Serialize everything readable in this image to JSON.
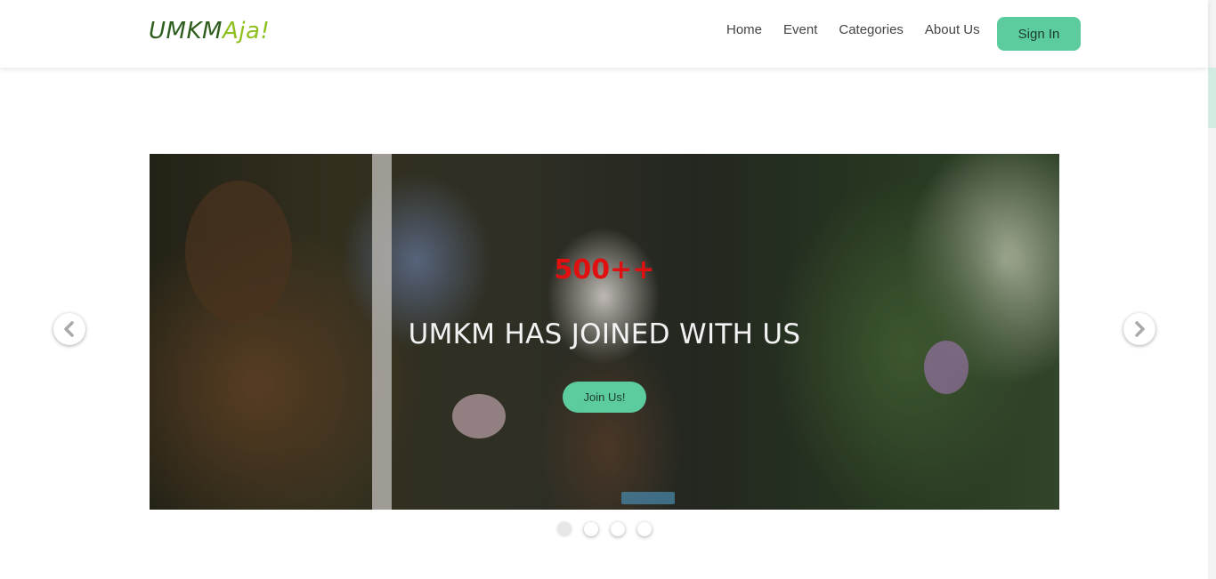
{
  "brand": {
    "logo_part1": "UMKM",
    "logo_part2": "Aja!",
    "logo_color1": "#2e5e1e",
    "logo_color2": "#8fbf1f"
  },
  "nav": {
    "links": [
      "Home",
      "Event",
      "Categories",
      "About Us"
    ],
    "sign_in_label": "Sign In"
  },
  "hero": {
    "count": "500++",
    "title": "UMKM HAS JOINED WITH US",
    "cta_label": "Join Us!",
    "prev_icon": "chevron-left-icon",
    "next_icon": "chevron-right-icon",
    "slides_total": 4,
    "active_slide": 1
  },
  "colors": {
    "accent": "#5ccb9e",
    "count_red": "#e01010"
  }
}
